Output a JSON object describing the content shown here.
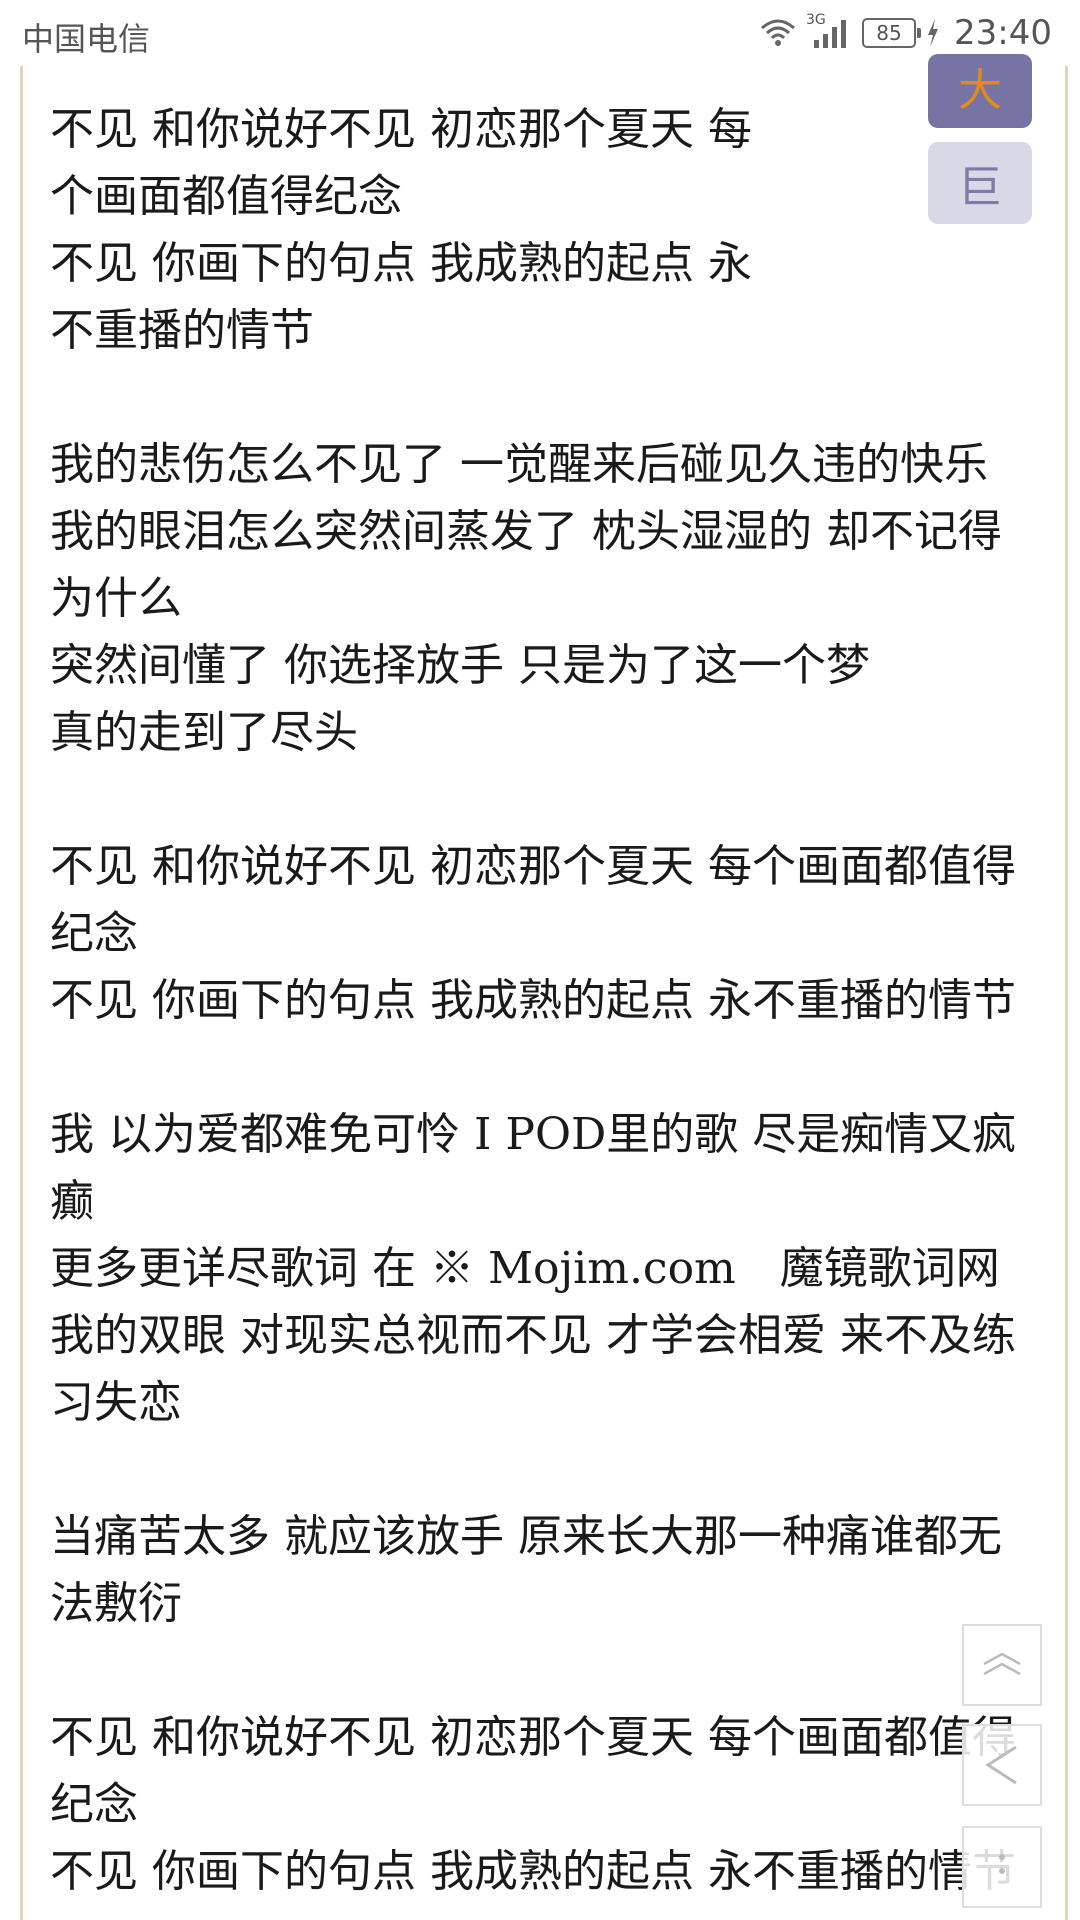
{
  "status_bar": {
    "carrier": "中国电信",
    "network": "3G",
    "battery": "85",
    "time": "23:40"
  },
  "font_buttons": {
    "big": "大",
    "huge": "巨"
  },
  "lyrics": [
    "不见 和你说好不见 初恋那个夏天 每",
    "个画面都值得纪念",
    "不见 你画下的句点 我成熟的起点 永",
    "不重播的情节",
    "",
    "我的悲伤怎么不见了 一觉醒来后碰见久违的快乐",
    "我的眼泪怎么突然间蒸发了 枕头湿湿的 却不记得",
    "为什么",
    "突然间懂了 你选择放手 只是为了这一个梦",
    "真的走到了尽头",
    "",
    "不见 和你说好不见 初恋那个夏天 每个画面都值得",
    "纪念",
    "不见 你画下的句点 我成熟的起点 永不重播的情节",
    "",
    "我 以为爱都难免可怜 I POD里的歌 尽是痴情又疯",
    "癫",
    "更多更详尽歌词 在 ※ Mojim.com　魔镜歌词网",
    "我的双眼 对现实总视而不见 才学会相爱 来不及练",
    "习失恋",
    "",
    "当痛苦太多 就应该放手 原来长大那一种痛谁都无",
    "法敷衍",
    "",
    "不见 和你说好不见 初恋那个夏天 每个画面都值得",
    "纪念",
    "不见 你画下的句点 我成熟的起点 永不重播的情节"
  ],
  "side_buttons": {
    "top_icon": "double-chevron-up-icon",
    "back_icon": "chevron-left-icon",
    "more_icon": "vertical-dots-icon"
  },
  "colors": {
    "frame_border": "#e3d3b7",
    "btn_big_bg": "#7574a4",
    "btn_big_text": "#e38a1c",
    "btn_huge_bg": "#d8d8e6",
    "btn_huge_text": "#7c7ca8"
  }
}
